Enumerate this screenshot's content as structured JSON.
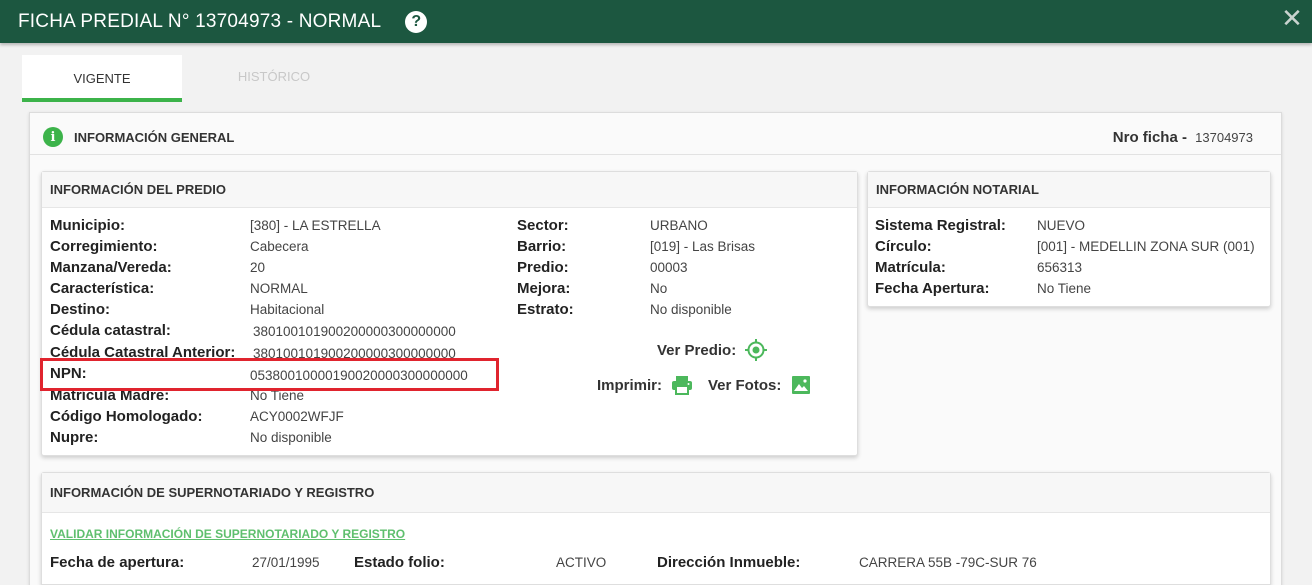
{
  "header": {
    "title": "FICHA PREDIAL N° 13704973 - NORMAL",
    "help_glyph": "?",
    "close_glyph": "✕"
  },
  "tabs": [
    {
      "label": "VIGENTE",
      "active": true
    },
    {
      "label": "HISTÓRICO",
      "active": false
    }
  ],
  "general": {
    "title": "INFORMACIÓN GENERAL",
    "nro_label": "Nro ficha -",
    "nro_value": "13704973"
  },
  "predio": {
    "title": "INFORMACIÓN DEL PREDIO",
    "left": [
      {
        "label": "Municipio:",
        "value": "[380] - LA ESTRELLA"
      },
      {
        "label": "Corregimiento:",
        "value": "Cabecera"
      },
      {
        "label": "Manzana/Vereda:",
        "value": "20"
      },
      {
        "label": "Característica:",
        "value": "NORMAL"
      },
      {
        "label": "Destino:",
        "value": "Habitacional"
      },
      {
        "label": "Cédula catastral:",
        "value": "380100101900200000300000000"
      },
      {
        "label": "Cédula Catastral Anterior:",
        "value": "380100101900200000300000000"
      },
      {
        "label": "NPN:",
        "value": "05380010000190020000300000000"
      },
      {
        "label": "Matrícula Madre:",
        "value": "No Tiene"
      },
      {
        "label": "Código Homologado:",
        "value": "ACY0002WFJF"
      },
      {
        "label": "Nupre:",
        "value": "No disponible"
      }
    ],
    "right": [
      {
        "label": "Sector:",
        "value": "URBANO"
      },
      {
        "label": "Barrio:",
        "value": "[019] - Las Brisas"
      },
      {
        "label": "Predio:",
        "value": "00003"
      },
      {
        "label": "Mejora:",
        "value": "No"
      },
      {
        "label": "Estrato:",
        "value": "No disponible"
      }
    ],
    "ver_predio": "Ver Predio:",
    "imprimir": "Imprimir:",
    "ver_fotos": "Ver Fotos:"
  },
  "notarial": {
    "title": "INFORMACIÓN NOTARIAL",
    "rows": [
      {
        "label": "Sistema Registral:",
        "value": "NUEVO"
      },
      {
        "label": "Círculo:",
        "value": "[001] - MEDELLIN ZONA SUR (001)"
      },
      {
        "label": "Matrícula:",
        "value": "656313"
      },
      {
        "label": "Fecha Apertura:",
        "value": "No Tiene"
      }
    ]
  },
  "supernot": {
    "title": "INFORMACIÓN DE SUPERNOTARIADO Y REGISTRO",
    "link": "VALIDAR INFORMACIÓN DE SUPERNOTARIADO Y REGISTRO",
    "fecha_label": "Fecha de apertura:",
    "fecha_value": "27/01/1995",
    "estado_label": "Estado folio:",
    "estado_value": "ACTIVO",
    "direccion_label": "Dirección Inmueble:",
    "direccion_value": "CARRERA 55B -79C-SUR 76"
  },
  "colors": {
    "header_bg": "#1c5740",
    "accent": "#3cb34a",
    "highlight": "#e0242e"
  }
}
